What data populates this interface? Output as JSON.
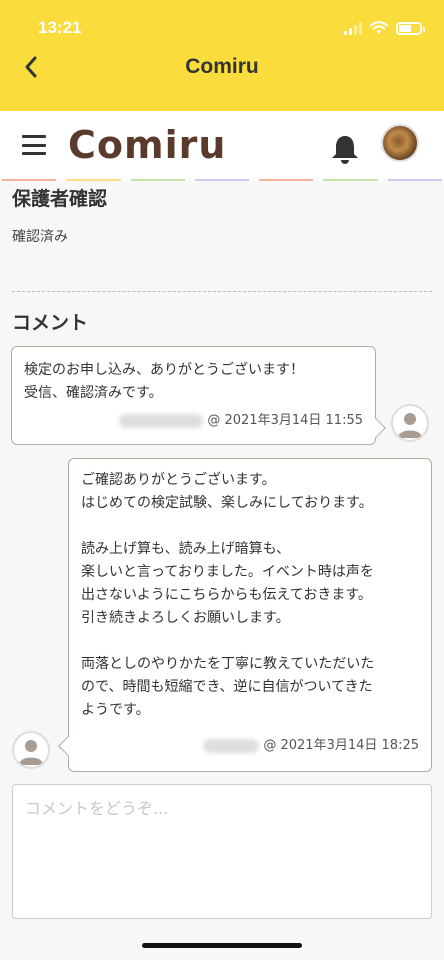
{
  "status_bar": {
    "time": "13:21"
  },
  "nav": {
    "title": "Comiru"
  },
  "app_header": {
    "logo_text": "Comiru"
  },
  "guardian": {
    "heading": "保護者確認",
    "status": "確認済み"
  },
  "comments": {
    "heading": "コメント",
    "items": [
      {
        "body": "検定のお申し込み、ありがとうございます！\n受信、確認済みです。",
        "date": "@ 2021年3月14日 11:55"
      },
      {
        "body": "ご確認ありがとうございます。\nはじめての検定試験、楽しみにしております。\n\n読み上げ算も、読み上げ暗算も、\n楽しいと言っておりました。イベント時は声を\n出さないようにこちらからも伝えておきます。\n引き続きよろしくお願いします。\n\n両落としのやりかたを丁寧に教えていただいた\nので、時間も短縮でき、逆に自信がついてきた\nようです。",
        "date": "@ 2021年3月14日 18:25"
      }
    ]
  },
  "comment_input": {
    "placeholder": "コメントをどうぞ..."
  },
  "colors": {
    "header_yellow": "#fadc3c",
    "bubble_border": "#b9a89c",
    "logo_brown": "#5a3a2a"
  },
  "icons": [
    "back-chevron-icon",
    "hamburger-menu-icon",
    "bell-icon",
    "user-avatar-icon",
    "wifi-icon",
    "battery-icon",
    "signal-icon"
  ]
}
